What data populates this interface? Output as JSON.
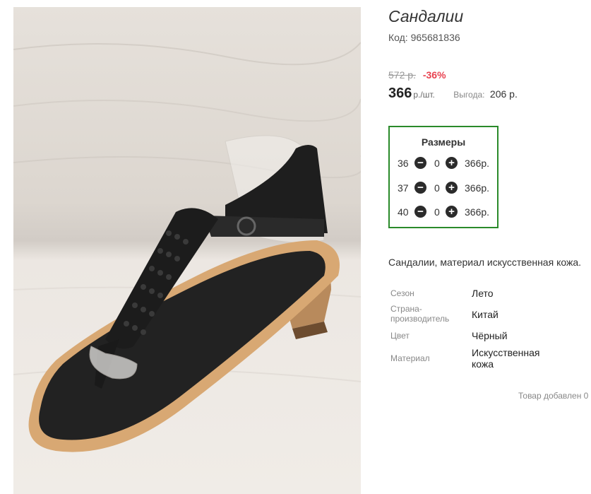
{
  "product": {
    "title": "Сандалии",
    "code": "Код: 965681836",
    "old_price": "572 р.",
    "discount": "-36%",
    "price": "366",
    "price_unit": "р./шт.",
    "savings_label": "Выгода:",
    "savings_value": "206 р."
  },
  "sizes": {
    "title": "Размеры",
    "rows": [
      {
        "size": "36",
        "qty": "0",
        "price": "366р."
      },
      {
        "size": "37",
        "qty": "0",
        "price": "366р."
      },
      {
        "size": "40",
        "qty": "0",
        "price": "366р."
      }
    ]
  },
  "description": "Сандалии, материал искусственная кожа.",
  "specs": [
    {
      "label": "Сезон",
      "value": "Лето"
    },
    {
      "label": "Страна-\nпроизводитель",
      "value": "Китай"
    },
    {
      "label": "Цвет",
      "value": "Чёрный"
    },
    {
      "label": "Материал",
      "value": "Искусственная\nкожа"
    }
  ],
  "added_text": "Товар добавлен 0",
  "icons": {
    "minus": "minus-circle-icon",
    "plus": "plus-circle-icon"
  },
  "colors": {
    "sizes_border": "#2a8a2a",
    "discount": "#e8414f"
  }
}
